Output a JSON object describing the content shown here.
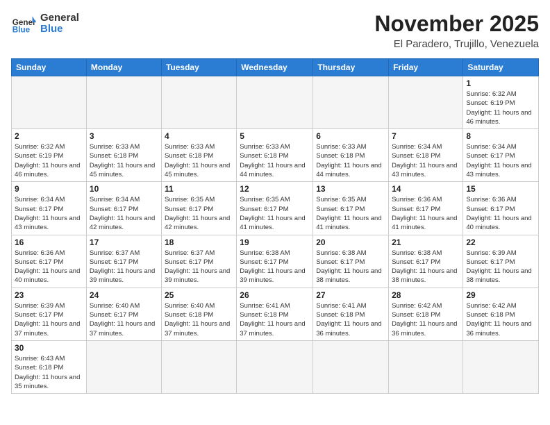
{
  "header": {
    "logo_general": "General",
    "logo_blue": "Blue",
    "month_title": "November 2025",
    "subtitle": "El Paradero, Trujillo, Venezuela"
  },
  "weekdays": [
    "Sunday",
    "Monday",
    "Tuesday",
    "Wednesday",
    "Thursday",
    "Friday",
    "Saturday"
  ],
  "days": {
    "d1": {
      "num": "1",
      "sunrise": "6:32 AM",
      "sunset": "6:19 PM",
      "daylight": "11 hours and 46 minutes."
    },
    "d2": {
      "num": "2",
      "sunrise": "6:32 AM",
      "sunset": "6:19 PM",
      "daylight": "11 hours and 46 minutes."
    },
    "d3": {
      "num": "3",
      "sunrise": "6:33 AM",
      "sunset": "6:18 PM",
      "daylight": "11 hours and 45 minutes."
    },
    "d4": {
      "num": "4",
      "sunrise": "6:33 AM",
      "sunset": "6:18 PM",
      "daylight": "11 hours and 45 minutes."
    },
    "d5": {
      "num": "5",
      "sunrise": "6:33 AM",
      "sunset": "6:18 PM",
      "daylight": "11 hours and 44 minutes."
    },
    "d6": {
      "num": "6",
      "sunrise": "6:33 AM",
      "sunset": "6:18 PM",
      "daylight": "11 hours and 44 minutes."
    },
    "d7": {
      "num": "7",
      "sunrise": "6:34 AM",
      "sunset": "6:18 PM",
      "daylight": "11 hours and 43 minutes."
    },
    "d8": {
      "num": "8",
      "sunrise": "6:34 AM",
      "sunset": "6:17 PM",
      "daylight": "11 hours and 43 minutes."
    },
    "d9": {
      "num": "9",
      "sunrise": "6:34 AM",
      "sunset": "6:17 PM",
      "daylight": "11 hours and 43 minutes."
    },
    "d10": {
      "num": "10",
      "sunrise": "6:34 AM",
      "sunset": "6:17 PM",
      "daylight": "11 hours and 42 minutes."
    },
    "d11": {
      "num": "11",
      "sunrise": "6:35 AM",
      "sunset": "6:17 PM",
      "daylight": "11 hours and 42 minutes."
    },
    "d12": {
      "num": "12",
      "sunrise": "6:35 AM",
      "sunset": "6:17 PM",
      "daylight": "11 hours and 41 minutes."
    },
    "d13": {
      "num": "13",
      "sunrise": "6:35 AM",
      "sunset": "6:17 PM",
      "daylight": "11 hours and 41 minutes."
    },
    "d14": {
      "num": "14",
      "sunrise": "6:36 AM",
      "sunset": "6:17 PM",
      "daylight": "11 hours and 41 minutes."
    },
    "d15": {
      "num": "15",
      "sunrise": "6:36 AM",
      "sunset": "6:17 PM",
      "daylight": "11 hours and 40 minutes."
    },
    "d16": {
      "num": "16",
      "sunrise": "6:36 AM",
      "sunset": "6:17 PM",
      "daylight": "11 hours and 40 minutes."
    },
    "d17": {
      "num": "17",
      "sunrise": "6:37 AM",
      "sunset": "6:17 PM",
      "daylight": "11 hours and 39 minutes."
    },
    "d18": {
      "num": "18",
      "sunrise": "6:37 AM",
      "sunset": "6:17 PM",
      "daylight": "11 hours and 39 minutes."
    },
    "d19": {
      "num": "19",
      "sunrise": "6:38 AM",
      "sunset": "6:17 PM",
      "daylight": "11 hours and 39 minutes."
    },
    "d20": {
      "num": "20",
      "sunrise": "6:38 AM",
      "sunset": "6:17 PM",
      "daylight": "11 hours and 38 minutes."
    },
    "d21": {
      "num": "21",
      "sunrise": "6:38 AM",
      "sunset": "6:17 PM",
      "daylight": "11 hours and 38 minutes."
    },
    "d22": {
      "num": "22",
      "sunrise": "6:39 AM",
      "sunset": "6:17 PM",
      "daylight": "11 hours and 38 minutes."
    },
    "d23": {
      "num": "23",
      "sunrise": "6:39 AM",
      "sunset": "6:17 PM",
      "daylight": "11 hours and 37 minutes."
    },
    "d24": {
      "num": "24",
      "sunrise": "6:40 AM",
      "sunset": "6:17 PM",
      "daylight": "11 hours and 37 minutes."
    },
    "d25": {
      "num": "25",
      "sunrise": "6:40 AM",
      "sunset": "6:18 PM",
      "daylight": "11 hours and 37 minutes."
    },
    "d26": {
      "num": "26",
      "sunrise": "6:41 AM",
      "sunset": "6:18 PM",
      "daylight": "11 hours and 37 minutes."
    },
    "d27": {
      "num": "27",
      "sunrise": "6:41 AM",
      "sunset": "6:18 PM",
      "daylight": "11 hours and 36 minutes."
    },
    "d28": {
      "num": "28",
      "sunrise": "6:42 AM",
      "sunset": "6:18 PM",
      "daylight": "11 hours and 36 minutes."
    },
    "d29": {
      "num": "29",
      "sunrise": "6:42 AM",
      "sunset": "6:18 PM",
      "daylight": "11 hours and 36 minutes."
    },
    "d30": {
      "num": "30",
      "sunrise": "6:43 AM",
      "sunset": "6:18 PM",
      "daylight": "11 hours and 35 minutes."
    }
  },
  "labels": {
    "sunrise": "Sunrise:",
    "sunset": "Sunset:",
    "daylight": "Daylight:"
  }
}
